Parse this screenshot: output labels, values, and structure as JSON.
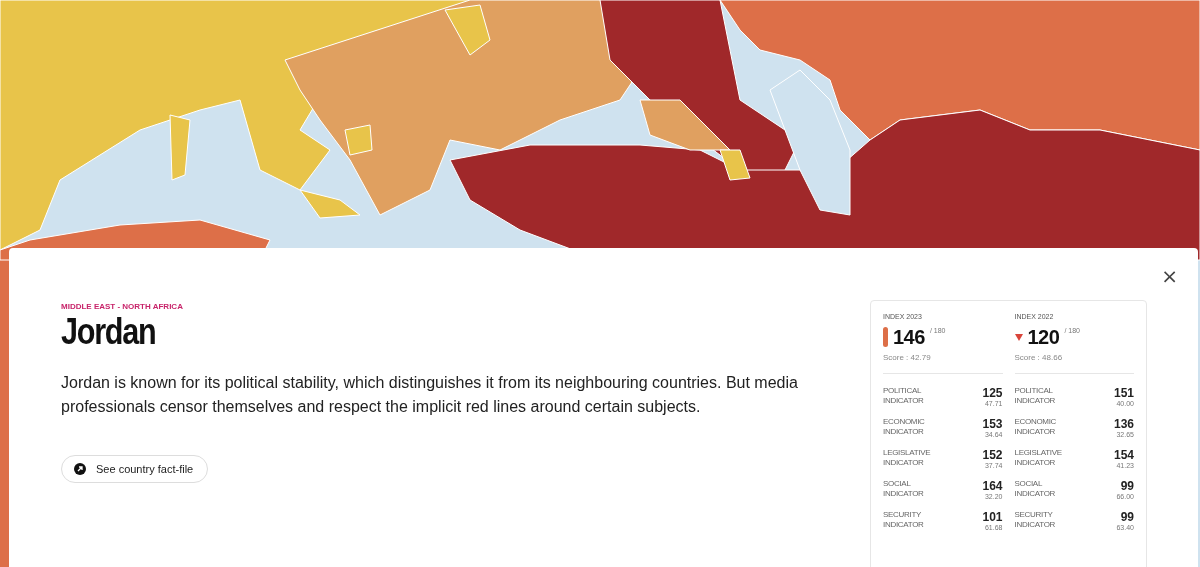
{
  "card": {
    "close": "×",
    "region": "MIDDLE EAST - NORTH AFRICA",
    "title": "Jordan",
    "description": "Jordan is known for its political stability, which distinguishes it from its neighbouring countries. But media professionals censor themselves and respect the implicit red lines around certain subjects.",
    "fact_file_button": "See country fact-file",
    "indices": [
      {
        "label": "INDEX 2023",
        "kind": "bar",
        "rank": "146",
        "total": "/ 180",
        "score": "Score : 42.79",
        "indicators": [
          {
            "name": "POLITICAL INDICATOR",
            "rank": "125",
            "score": "47.71"
          },
          {
            "name": "ECONOMIC INDICATOR",
            "rank": "153",
            "score": "34.64"
          },
          {
            "name": "LEGISLATIVE INDICATOR",
            "rank": "152",
            "score": "37.74"
          },
          {
            "name": "SOCIAL INDICATOR",
            "rank": "164",
            "score": "32.20"
          },
          {
            "name": "SECURITY INDICATOR",
            "rank": "101",
            "score": "61.68"
          }
        ]
      },
      {
        "label": "INDEX 2022",
        "kind": "down",
        "rank": "120",
        "total": "/ 180",
        "score": "Score : 48.66",
        "indicators": [
          {
            "name": "POLITICAL INDICATOR",
            "rank": "151",
            "score": "40.00"
          },
          {
            "name": "ECONOMIC INDICATOR",
            "rank": "136",
            "score": "32.65"
          },
          {
            "name": "LEGISLATIVE INDICATOR",
            "rank": "154",
            "score": "41.23"
          },
          {
            "name": "SOCIAL INDICATOR",
            "rank": "99",
            "score": "66.00"
          },
          {
            "name": "SECURITY INDICATOR",
            "rank": "99",
            "score": "63.40"
          }
        ]
      }
    ]
  }
}
